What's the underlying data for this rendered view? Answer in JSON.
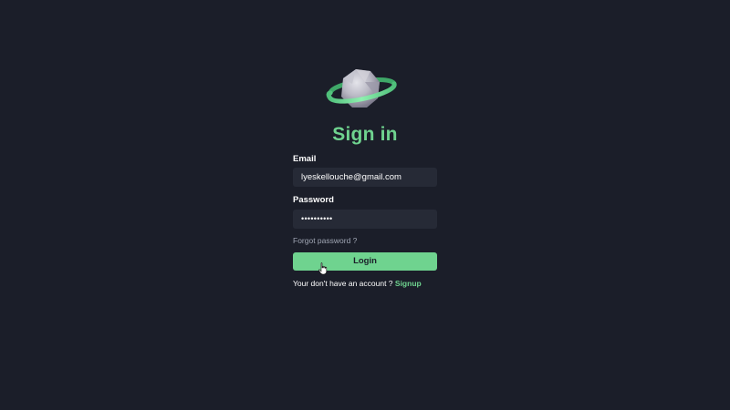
{
  "logo": {
    "icon": "planet-icon"
  },
  "title": "Sign in",
  "email": {
    "label": "Email",
    "value": "lyeskellouche@gmail.com"
  },
  "password": {
    "label": "Password",
    "value": "••••••••••"
  },
  "forgot_label": "Forgot password ?",
  "login_label": "Login",
  "signup": {
    "prompt": "Your don't have an account ? ",
    "link_label": "Signup"
  },
  "colors": {
    "background": "#1b1e29",
    "accent": "#6fd38f",
    "input_bg": "#262a36",
    "muted_text": "#a0a6b4"
  }
}
